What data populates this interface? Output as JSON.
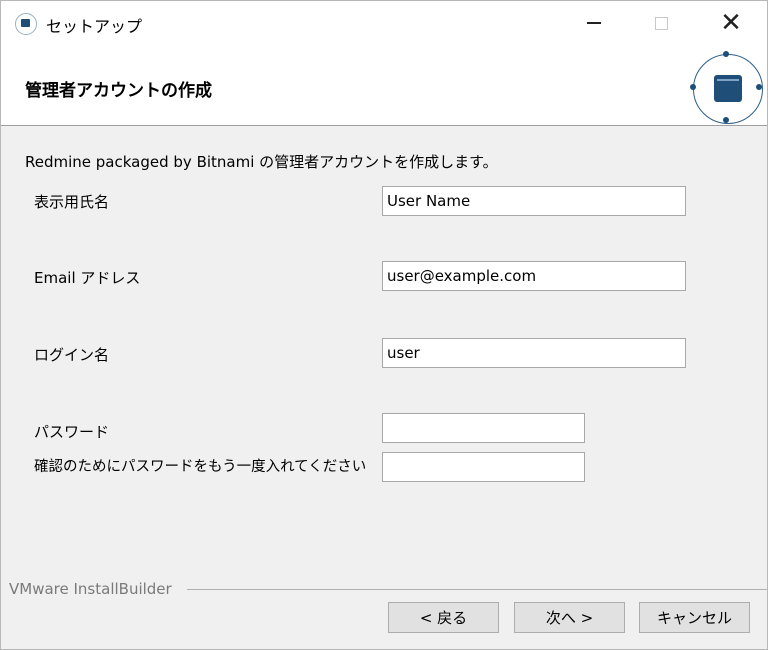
{
  "window": {
    "title": "セットアップ"
  },
  "header": {
    "title": "管理者アカウントの作成"
  },
  "intro": "Redmine packaged by Bitnami の管理者アカウントを作成します。",
  "form": {
    "display_name_label": "表示用氏名",
    "display_name_value": "User Name",
    "email_label": "Email アドレス",
    "email_value": "user@example.com",
    "login_label": "ログイン名",
    "login_value": "user",
    "password_label": "パスワード",
    "password_value": "",
    "confirm_label": "確認のためにパスワードをもう一度入れてください",
    "confirm_value": ""
  },
  "footer": {
    "brand": "VMware InstallBuilder",
    "back_label": "< 戻る",
    "next_label": "次へ >",
    "cancel_label": "キャンセル"
  },
  "colors": {
    "accent": "#1f4e79",
    "background": "#f0f0f0"
  },
  "icons": [
    "app-icon",
    "minimize-icon",
    "maximize-icon",
    "close-icon",
    "installer-logo-icon"
  ]
}
